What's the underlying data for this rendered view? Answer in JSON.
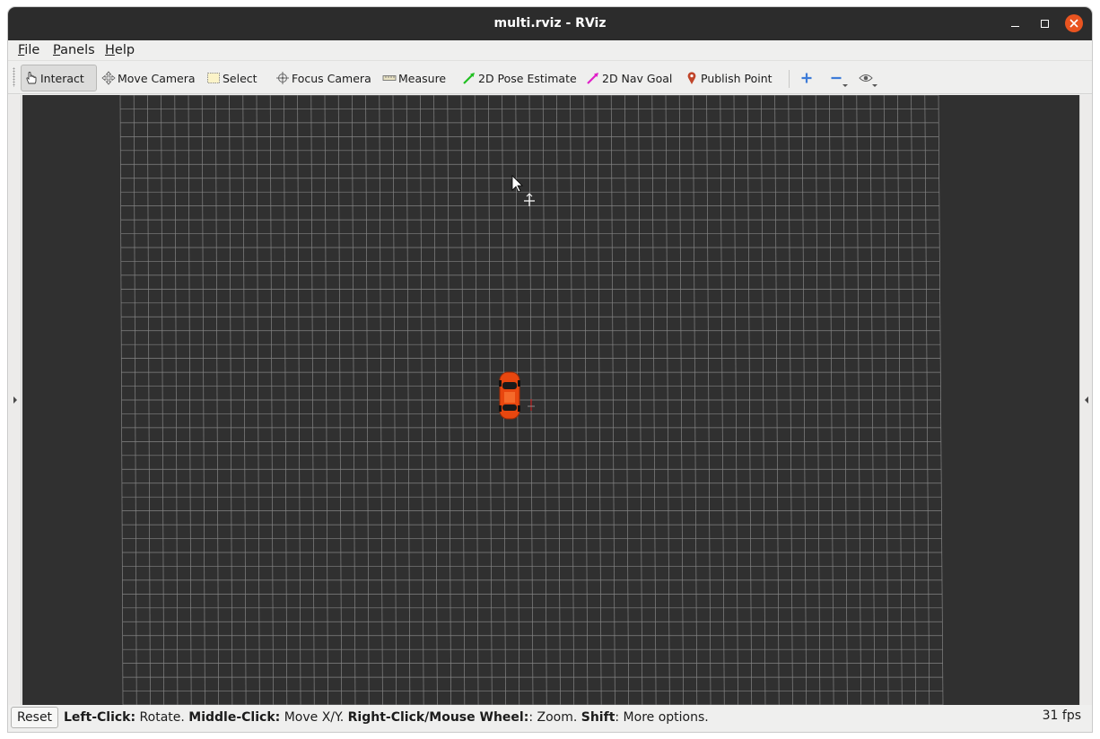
{
  "window": {
    "title": "multi.rviz - RViz",
    "controls": [
      "minimize",
      "maximize",
      "close"
    ]
  },
  "menu": [
    {
      "label": "File",
      "mnemonic": "F",
      "rest": "ile"
    },
    {
      "label": "Panels",
      "mnemonic": "P",
      "rest": "anels"
    },
    {
      "label": "Help",
      "mnemonic": "H",
      "rest": "elp"
    }
  ],
  "toolbar": {
    "tools": [
      {
        "label": "Interact",
        "icon": "hand-pointer-icon",
        "active": true
      },
      {
        "label": "Move Camera",
        "icon": "move-arrows-icon",
        "active": false
      },
      {
        "label": "Select",
        "icon": "selection-box-icon",
        "active": false
      },
      {
        "label": "Focus Camera",
        "icon": "crosshair-target-icon",
        "active": false
      },
      {
        "label": "Measure",
        "icon": "ruler-icon",
        "active": false
      },
      {
        "label": "2D Pose Estimate",
        "icon": "green-arrow-icon",
        "active": false
      },
      {
        "label": "2D Nav Goal",
        "icon": "magenta-arrow-icon",
        "active": false
      },
      {
        "label": "Publish Point",
        "icon": "map-pin-icon",
        "active": false
      }
    ],
    "extra": [
      "plus-icon",
      "minus-icon",
      "eye-icon"
    ]
  },
  "viewport": {
    "background": "#303030",
    "grid_color": "#a0a0a0",
    "vehicle_color": "#e8470f"
  },
  "status": {
    "reset_label": "Reset",
    "hint": [
      {
        "text": "Left-Click:",
        "bold": true
      },
      {
        "text": " Rotate. ",
        "bold": false
      },
      {
        "text": "Middle-Click:",
        "bold": true
      },
      {
        "text": " Move X/Y. ",
        "bold": false
      },
      {
        "text": "Right-Click/Mouse Wheel:",
        "bold": true
      },
      {
        "text": ": Zoom. ",
        "bold": false
      },
      {
        "text": "Shift",
        "bold": true
      },
      {
        "text": ": More options.",
        "bold": false
      }
    ],
    "fps": "31 fps"
  }
}
